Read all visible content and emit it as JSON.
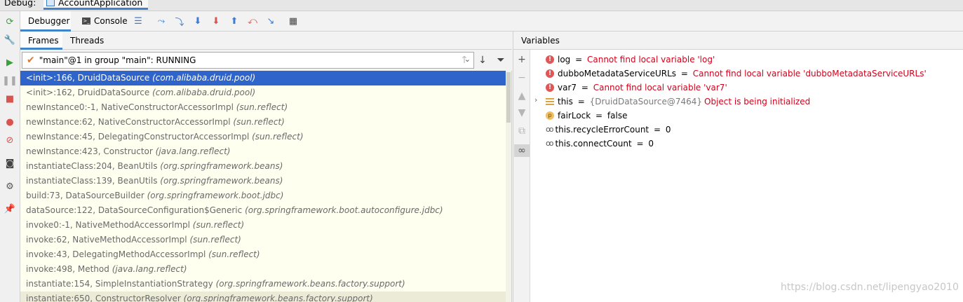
{
  "topbar": {
    "debug_label": "Debug:",
    "run_config": "AccountApplication"
  },
  "toolbar": {
    "debugger_tab": "Debugger",
    "console_tab": "Console",
    "console_icon_glyph": ">_",
    "icons": [
      "menu-icon",
      "show-execution-point-icon",
      "step-over-icon",
      "step-into-icon",
      "force-step-into-icon",
      "step-out-icon",
      "drop-frame-icon",
      "run-to-cursor-icon",
      "evaluate-expression-icon"
    ]
  },
  "frames_panel": {
    "tabs": {
      "frames": "Frames",
      "threads": "Threads"
    },
    "thread_selector": "\"main\"@1 in group \"main\": RUNNING",
    "frames": [
      {
        "method": "<init>:166, DruidDataSource",
        "pkg": "(com.alibaba.druid.pool)"
      },
      {
        "method": "<init>:162, DruidDataSource",
        "pkg": "(com.alibaba.druid.pool)"
      },
      {
        "method": "newInstance0:-1, NativeConstructorAccessorImpl",
        "pkg": "(sun.reflect)"
      },
      {
        "method": "newInstance:62, NativeConstructorAccessorImpl",
        "pkg": "(sun.reflect)"
      },
      {
        "method": "newInstance:45, DelegatingConstructorAccessorImpl",
        "pkg": "(sun.reflect)"
      },
      {
        "method": "newInstance:423, Constructor",
        "pkg": "(java.lang.reflect)"
      },
      {
        "method": "instantiateClass:204, BeanUtils",
        "pkg": "(org.springframework.beans)"
      },
      {
        "method": "instantiateClass:139, BeanUtils",
        "pkg": "(org.springframework.beans)"
      },
      {
        "method": "build:73, DataSourceBuilder",
        "pkg": "(org.springframework.boot.jdbc)"
      },
      {
        "method": "dataSource:122, DataSourceConfiguration$Generic",
        "pkg": "(org.springframework.boot.autoconfigure.jdbc)"
      },
      {
        "method": "invoke0:-1, NativeMethodAccessorImpl",
        "pkg": "(sun.reflect)"
      },
      {
        "method": "invoke:62, NativeMethodAccessorImpl",
        "pkg": "(sun.reflect)"
      },
      {
        "method": "invoke:43, DelegatingMethodAccessorImpl",
        "pkg": "(sun.reflect)"
      },
      {
        "method": "invoke:498, Method",
        "pkg": "(java.lang.reflect)"
      },
      {
        "method": "instantiate:154, SimpleInstantiationStrategy",
        "pkg": "(org.springframework.beans.factory.support)"
      },
      {
        "method": "instantiate:650, ConstructorResolver",
        "pkg": "(org.springframework.beans.factory.support)"
      }
    ]
  },
  "variables_panel": {
    "title": "Variables",
    "items": [
      {
        "name": "log",
        "eq": " = ",
        "value": "Cannot find local variable 'log'"
      },
      {
        "name": "dubboMetadataServiceURLs",
        "eq": " = ",
        "value": "Cannot find local variable 'dubboMetadataServiceURLs'"
      },
      {
        "name": "var7",
        "eq": " = ",
        "value": "Cannot find local variable 'var7'"
      },
      {
        "name": "this",
        "eq": " = ",
        "ref": "{DruidDataSource@7464}",
        "value": "Object is being initialized"
      },
      {
        "name": "fairLock",
        "eq": " = ",
        "value": "false"
      },
      {
        "name": "this.recycleErrorCount",
        "eq": " = ",
        "value": "0"
      },
      {
        "name": "this.connectCount",
        "eq": " = ",
        "value": "0"
      }
    ]
  },
  "watermark": "https://blog.csdn.net/lipengyao2010",
  "colors": {
    "selection": "#2f65ca",
    "accent": "#4083c9",
    "error": "#d0021b",
    "frames_bg": "#fffff0"
  }
}
